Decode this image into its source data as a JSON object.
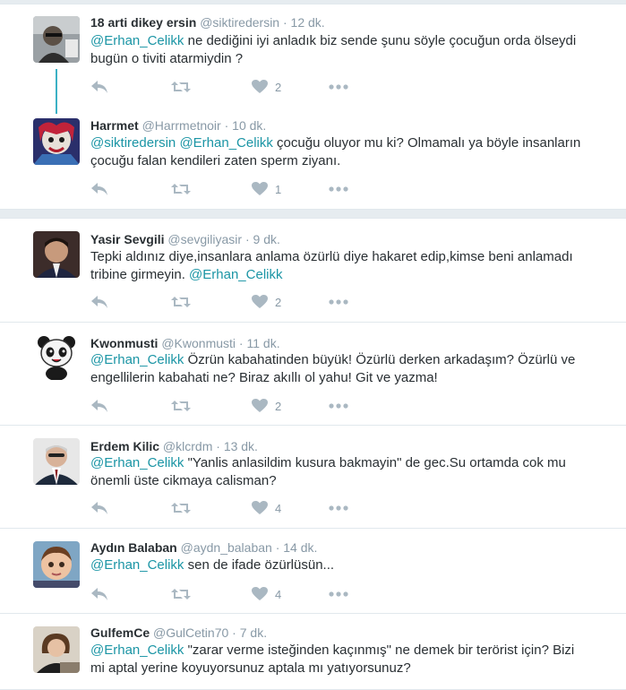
{
  "tweets": [
    {
      "name": "18 arti dikey ersin",
      "handle": "@siktiredersin",
      "dot": "·",
      "time": "12 dk.",
      "segments": [
        {
          "t": "@Erhan_Celikk",
          "m": true
        },
        {
          "t": " ne dediğini iyi anladık biz sende şunu söyle çocuğun orda ölseydi bugün o tiviti atarmiydin ?",
          "m": false
        }
      ],
      "likes": "2"
    },
    {
      "name": "Harrmet",
      "handle": "@Harrmetnoir",
      "dot": "·",
      "time": "10 dk.",
      "segments": [
        {
          "t": "@siktiredersin",
          "m": true
        },
        {
          "t": " ",
          "m": false
        },
        {
          "t": "@Erhan_Celikk",
          "m": true
        },
        {
          "t": " çocuğu oluyor mu ki? Olmamalı ya böyle insanların çocuğu falan kendileri zaten sperm ziyanı.",
          "m": false
        }
      ],
      "likes": "1"
    },
    {
      "name": "Yasir Sevgili",
      "handle": "@sevgiliyasir",
      "dot": "·",
      "time": "9 dk.",
      "segments": [
        {
          "t": "Tepki aldınız diye,insanlara anlama özürlü diye hakaret edip,kimse beni anlamadı tribine girmeyin. ",
          "m": false
        },
        {
          "t": "@Erhan_Celikk",
          "m": true
        }
      ],
      "likes": "2"
    },
    {
      "name": "Kwonmusti",
      "handle": "@Kwonmusti",
      "dot": "·",
      "time": "11 dk.",
      "segments": [
        {
          "t": "@Erhan_Celikk",
          "m": true
        },
        {
          "t": " Özrün kabahatinden büyük! Özürlü derken arkadaşım? Özürlü ve engellilerin kabahati ne? Biraz akıllı ol yahu! Git ve yazma!",
          "m": false
        }
      ],
      "likes": "2"
    },
    {
      "name": "Erdem Kilic",
      "handle": "@klcrdm",
      "dot": "·",
      "time": "13 dk.",
      "segments": [
        {
          "t": "@Erhan_Celikk",
          "m": true
        },
        {
          "t": " \"Yanlis anlasildim kusura bakmayin\" de gec.Su ortamda cok mu önemli üste cikmaya calisman?",
          "m": false
        }
      ],
      "likes": "4"
    },
    {
      "name": "Aydın Balaban",
      "handle": "@aydn_balaban",
      "dot": "·",
      "time": "14 dk.",
      "segments": [
        {
          "t": "@Erhan_Celikk",
          "m": true
        },
        {
          "t": " sen de ifade özürlüsün...",
          "m": false
        }
      ],
      "likes": "4"
    },
    {
      "name": "GulfemCe",
      "handle": "@GulCetin70",
      "dot": "·",
      "time": "7 dk.",
      "segments": [
        {
          "t": "@Erhan_Celikk",
          "m": true
        },
        {
          "t": " \"zarar verme isteğinden kaçınmış\" ne demek bir terörist için? Bizi mi aptal yerine koyuyorsunuz aptala mı yatıyorsunuz?",
          "m": false
        }
      ],
      "likes": ""
    }
  ],
  "colors": {
    "mention": "#1b95a5",
    "thread_line": "#3bb1c5",
    "meta": "#8899a6",
    "icon": "#aab8c2"
  }
}
